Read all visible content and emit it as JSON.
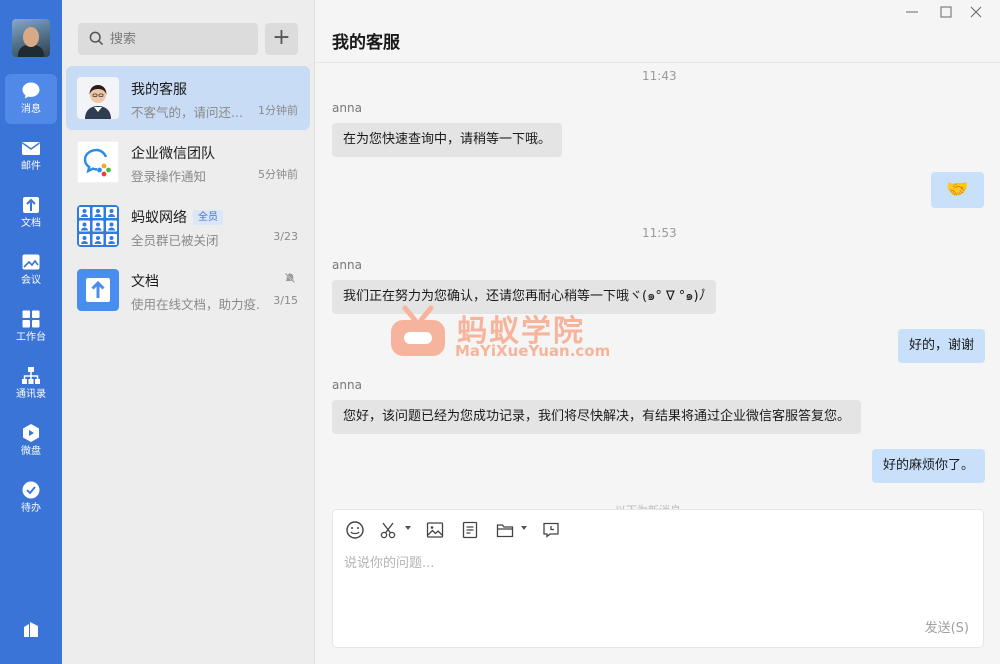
{
  "nav": {
    "items": [
      {
        "label": "消息",
        "icon": "chat-bubble-icon"
      },
      {
        "label": "邮件",
        "icon": "mail-icon"
      },
      {
        "label": "文档",
        "icon": "document-icon"
      },
      {
        "label": "会议",
        "icon": "meeting-icon"
      },
      {
        "label": "工作台",
        "icon": "workbench-grid-icon"
      },
      {
        "label": "通讯录",
        "icon": "contacts-org-icon"
      },
      {
        "label": "微盘",
        "icon": "cloud-drive-icon"
      },
      {
        "label": "待办",
        "icon": "todo-check-icon"
      }
    ],
    "bottom_icon": "buildings-icon",
    "active_color": "#5189e8",
    "rail_color": "#3a74d6"
  },
  "search": {
    "placeholder": "搜索"
  },
  "add_button": "+",
  "conversations": [
    {
      "name": "我的客服",
      "preview": "不客气的，请问还...",
      "time": "1分钟前",
      "active": true
    },
    {
      "name": "企业微信团队",
      "preview": "登录操作通知",
      "time": "5分钟前"
    },
    {
      "name": "蚂蚁网络",
      "badge": "全员",
      "preview": "全员群已被关闭",
      "time": "3/23"
    },
    {
      "name": "文档",
      "preview": "使用在线文档，助力疫...",
      "time": "3/15",
      "muted": true
    }
  ],
  "chat": {
    "title": "我的客服",
    "messages": [
      {
        "type": "timestamp",
        "text": "11:43"
      },
      {
        "type": "sender",
        "text": "anna"
      },
      {
        "type": "in",
        "text": "在为您快速查询中，请稍等一下哦。"
      },
      {
        "type": "out",
        "text": "🤝"
      },
      {
        "type": "timestamp",
        "text": "11:53"
      },
      {
        "type": "sender",
        "text": "anna"
      },
      {
        "type": "in",
        "text": "我们正在努力为您确认，还请您再耐心稍等一下哦ヾ(๑° ∇ °๑)ﾉ゙"
      },
      {
        "type": "out",
        "text": "好的，谢谢"
      },
      {
        "type": "sender",
        "text": "anna"
      },
      {
        "type": "in",
        "text": "您好，该问题已经为您成功记录，我们将尽快解决，有结果将通过企业微信客服答复您。"
      },
      {
        "type": "out",
        "text": "好的麻烦你了。"
      }
    ],
    "peek_text": "以下为新消息"
  },
  "watermark": {
    "text": "蚂蚁学院",
    "sub": "MaYiXueYuan.com"
  },
  "composer": {
    "placeholder": "说说你的问题...",
    "send_label": "发送(S)",
    "tools": [
      "emoji-icon",
      "scissors-icon",
      "image-icon",
      "note-icon",
      "folder-icon",
      "clock-bubble-icon"
    ]
  }
}
